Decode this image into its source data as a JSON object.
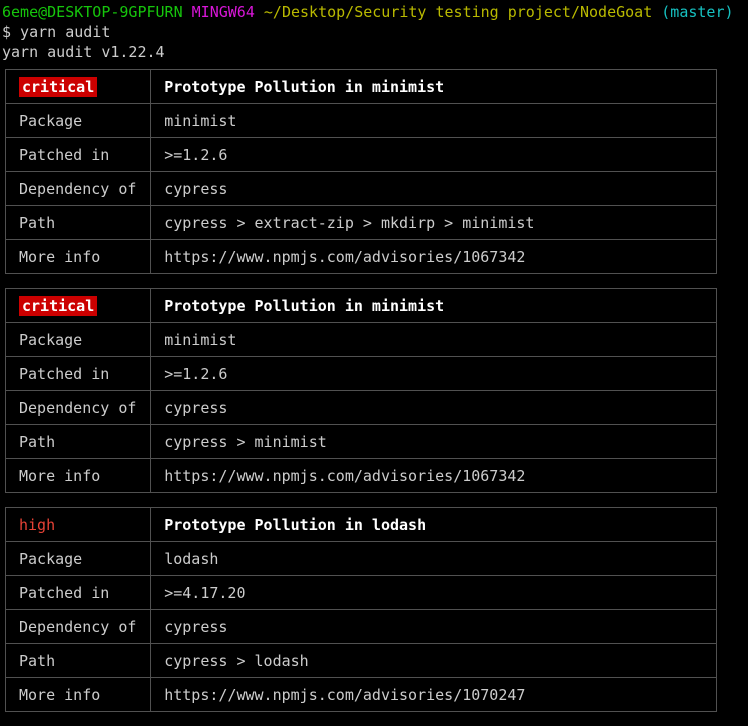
{
  "terminal": {
    "prompt": {
      "user_host": "6eme@DESKTOP-9GPFURN",
      "shell": "MINGW64",
      "path": "~/Desktop/Security testing project/NodeGoat",
      "branch": "(master)"
    },
    "command_line": "$ yarn audit",
    "version_line": "yarn audit v1.22.4",
    "colors": {
      "background": "#000000",
      "user_host": "#16c60c",
      "shell": "#d916d9",
      "path": "#b9b900",
      "branch": "#16c1c1",
      "text": "#cccccc",
      "border": "#515151",
      "critical_badge_bg": "#cc0000",
      "critical_badge_fg": "#ffffff",
      "high_text": "#e74236",
      "title_text": "#ffffff"
    }
  },
  "row_labels": {
    "package": "Package",
    "patched_in": "Patched in",
    "dependency_of": "Dependency of",
    "path": "Path",
    "more_info": "More info"
  },
  "advisories": [
    {
      "severity": "critical",
      "severity_style": "critical",
      "title": "Prototype Pollution in minimist",
      "package": "minimist",
      "patched_in": ">=1.2.6",
      "dependency_of": "cypress",
      "path": "cypress > extract-zip > mkdirp > minimist",
      "more_info": "https://www.npmjs.com/advisories/1067342"
    },
    {
      "severity": "critical",
      "severity_style": "critical",
      "title": "Prototype Pollution in minimist",
      "package": "minimist",
      "patched_in": ">=1.2.6",
      "dependency_of": "cypress",
      "path": "cypress > minimist",
      "more_info": "https://www.npmjs.com/advisories/1067342"
    },
    {
      "severity": "high",
      "severity_style": "high",
      "title": "Prototype Pollution in lodash",
      "package": "lodash",
      "patched_in": ">=4.17.20",
      "dependency_of": "cypress",
      "path": "cypress > lodash",
      "more_info": "https://www.npmjs.com/advisories/1070247"
    }
  ]
}
